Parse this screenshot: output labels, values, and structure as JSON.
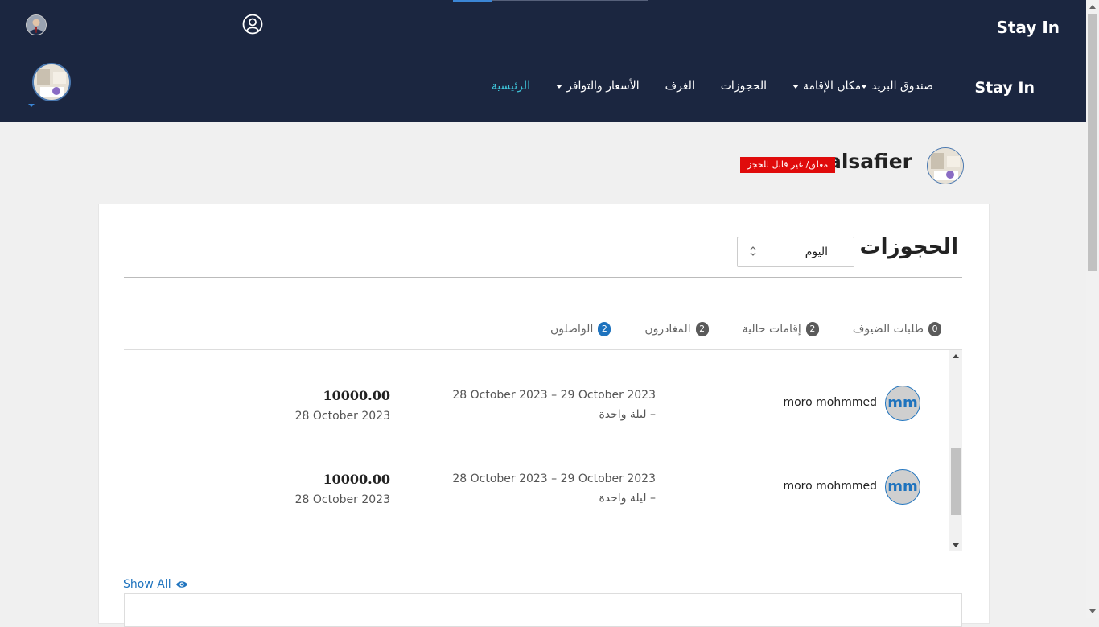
{
  "header": {
    "brand_top": "Stay In",
    "brand_nav": "Stay In",
    "nav": [
      {
        "label": "الرئيسية",
        "active": true,
        "dropdown": false
      },
      {
        "label": "الأسعار والتوافر",
        "active": false,
        "dropdown": true
      },
      {
        "label": "الغرف",
        "active": false,
        "dropdown": false
      },
      {
        "label": "الحجوزات",
        "active": false,
        "dropdown": false
      },
      {
        "label": "مكان الإقامة",
        "active": false,
        "dropdown": true
      },
      {
        "label": "صندوق البريد",
        "active": false,
        "dropdown": true
      }
    ],
    "icons": {
      "user": "user-circle-icon",
      "caret": "chevron-down-icon"
    }
  },
  "hotel": {
    "name": "alsafier",
    "status": "مغلق/ غير قابل للحجز"
  },
  "bookings": {
    "title": "الحجوزات",
    "period": {
      "selected": "اليوم"
    },
    "tabs": [
      {
        "label": "الواصلون",
        "count": "2",
        "active": true
      },
      {
        "label": "المغادرون",
        "count": "2",
        "active": false
      },
      {
        "label": "إقامات حالية",
        "count": "2",
        "active": false
      },
      {
        "label": "طلبات الضيوف",
        "count": "0",
        "active": false
      }
    ],
    "rows": [
      {
        "initials": "mm",
        "guest": "moro mohmmed",
        "date_range": "28 October 2023 – 29 October 2023",
        "nights": "ليلة واحدة –",
        "price": "10000.00",
        "booked_on": "28 October 2023"
      },
      {
        "initials": "mm",
        "guest": "moro mohmmed",
        "date_range": "28 October 2023 – 29 October 2023",
        "nights": "ليلة واحدة –",
        "price": "10000.00",
        "booked_on": "28 October 2023"
      }
    ],
    "show_all": "Show All"
  },
  "colors": {
    "header_bg": "#1b2640",
    "active_nav": "#3ec3d8",
    "accent": "#1e73be",
    "status_red": "#e00b0b"
  }
}
